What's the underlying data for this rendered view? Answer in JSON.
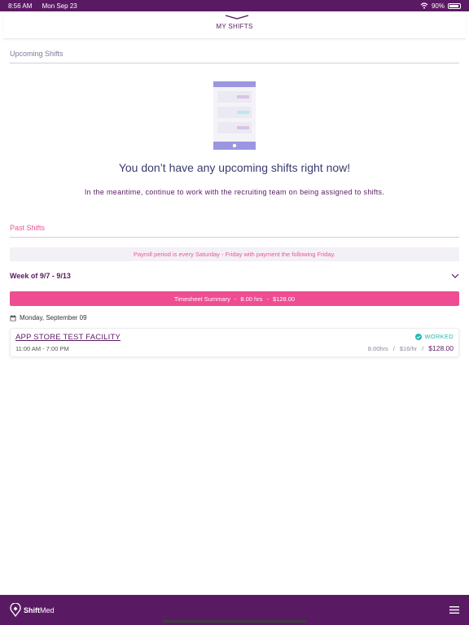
{
  "status_bar": {
    "time": "8:56 AM",
    "date": "Mon Sep 23",
    "battery": "90%"
  },
  "header": {
    "title": "MY SHIFTS"
  },
  "upcoming": {
    "title": "Upcoming Shifts",
    "empty_title": "You don’t have any upcoming shifts right now!",
    "empty_subtitle": "In the meantime, continue to work with the recruiting team on being assigned to shifts."
  },
  "past": {
    "title": "Past Shifts",
    "payroll_note": "Payroll period is every Saturday - Friday with payment the following Friday.",
    "week_label": "Week of 9/7 - 9/13",
    "summary": {
      "label": "Timesheet Summary",
      "hours": "8.00 hrs",
      "amount": "$128.00"
    },
    "day_label": "Monday, September 09",
    "shift": {
      "facility": "APP STORE TEST FACILITY",
      "time": "11:00 AM - 7:00 PM",
      "status": "WORKED",
      "hours": "8.00hrs",
      "rate": "$16/hr",
      "total": "$128.00"
    }
  },
  "footer": {
    "brand_bold": "Shift",
    "brand_light": "Med"
  },
  "colors": {
    "brand_purple": "#5a1a63",
    "accent_pink": "#ee4d91",
    "worked_teal": "#22b8b0"
  },
  "icons": [
    "wifi-icon",
    "battery-icon",
    "tab-chevron-icon",
    "empty-shifts-illustration",
    "chevron-down-icon",
    "calendar-icon",
    "check-circle-icon",
    "shiftmed-logo-icon",
    "menu-icon"
  ]
}
